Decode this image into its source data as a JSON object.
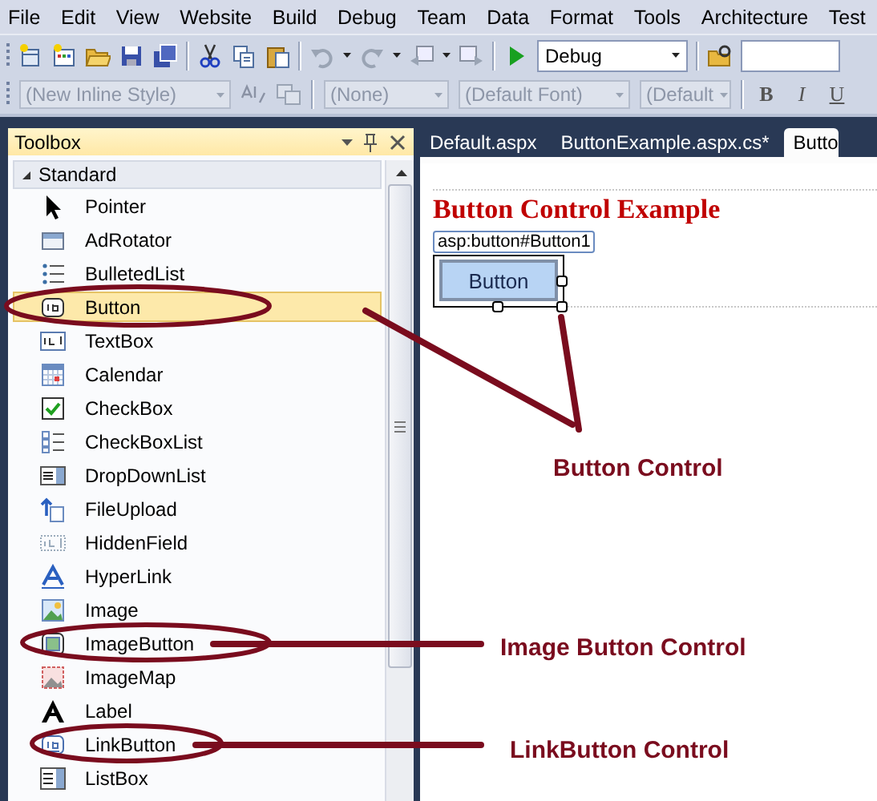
{
  "menu": [
    "File",
    "Edit",
    "View",
    "Website",
    "Build",
    "Debug",
    "Team",
    "Data",
    "Format",
    "Tools",
    "Architecture",
    "Test"
  ],
  "standard_toolbar": {
    "configuration": "Debug"
  },
  "formatting_toolbar": {
    "combos": [
      {
        "value": "(New Inline Style)",
        "disabled": true
      },
      {
        "value": "(None)",
        "disabled": true
      },
      {
        "value": "(Default Font)",
        "disabled": true
      },
      {
        "value": "(Default",
        "disabled": true
      }
    ],
    "format_buttons": [
      "B",
      "I",
      "U"
    ]
  },
  "toolbox": {
    "title": "Toolbox",
    "group": {
      "label": "Standard",
      "expanded": true
    },
    "items": [
      {
        "label": "Pointer",
        "selected": false
      },
      {
        "label": "AdRotator",
        "selected": false
      },
      {
        "label": "BulletedList",
        "selected": false
      },
      {
        "label": "Button",
        "selected": true
      },
      {
        "label": "TextBox",
        "selected": false
      },
      {
        "label": "Calendar",
        "selected": false
      },
      {
        "label": "CheckBox",
        "selected": false
      },
      {
        "label": "CheckBoxList",
        "selected": false
      },
      {
        "label": "DropDownList",
        "selected": false
      },
      {
        "label": "FileUpload",
        "selected": false
      },
      {
        "label": "HiddenField",
        "selected": false
      },
      {
        "label": "HyperLink",
        "selected": false
      },
      {
        "label": "Image",
        "selected": false
      },
      {
        "label": "ImageButton",
        "selected": false
      },
      {
        "label": "ImageMap",
        "selected": false
      },
      {
        "label": "Label",
        "selected": false
      },
      {
        "label": "LinkButton",
        "selected": false
      },
      {
        "label": "ListBox",
        "selected": false
      }
    ]
  },
  "document": {
    "tabs": [
      {
        "label": "Default.aspx",
        "selected": false
      },
      {
        "label": "ButtonExample.aspx.cs*",
        "selected": false
      },
      {
        "label": "Butto",
        "selected": true
      }
    ],
    "heading": "Button Control Example",
    "control_tag": "asp:button#Button1",
    "button_label": "Button"
  },
  "annotations": [
    {
      "label": "Button Control"
    },
    {
      "label": "Image Button Control"
    },
    {
      "label": "LinkButton Control"
    }
  ]
}
